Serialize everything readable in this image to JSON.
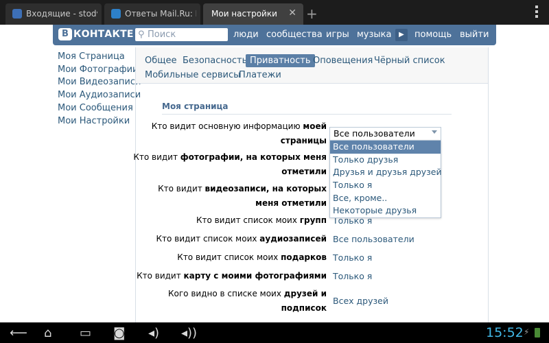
{
  "browser": {
    "tabs": [
      {
        "title": "Входящие - stodv…",
        "active": false
      },
      {
        "title": "Ответы Mail.Ru: В…",
        "active": false
      },
      {
        "title": "Мои настройки",
        "active": true
      }
    ]
  },
  "vk": {
    "logo_letter": "В",
    "logo_text": "КОНТАКТЕ",
    "search_placeholder": "Поиск",
    "nav": [
      "люди",
      "сообщества",
      "игры",
      "музыка",
      "помощь",
      "выйти"
    ]
  },
  "left_menu": [
    "Моя Страница",
    "Мои Фотографии",
    "Мои Видеозаписи",
    "Мои Аудиозаписи",
    "Мои Сообщения",
    "Мои Настройки"
  ],
  "settings": {
    "tabs_row1": [
      "Общее",
      "Безопасность",
      "Приватность",
      "Оповещения",
      "Чёрный список"
    ],
    "tabs_row2": [
      "Мобильные сервисы",
      "Платежи"
    ],
    "active_tab": "Приватность",
    "section_title": "Моя страница",
    "rows": [
      {
        "label_pre": "Кто видит основную информацию ",
        "label_bold": "моей",
        "label2_bold": "страницы",
        "value": "Все пользователи"
      },
      {
        "label_pre": "Кто видит ",
        "label_bold": "фотографии, на которых меня",
        "label2_bold": "отметили",
        "value": ""
      },
      {
        "label_pre": "Кто видит ",
        "label_bold": "видеозаписи, на которых",
        "label2_bold": "меня отметили",
        "value": ""
      },
      {
        "label_pre": "Кто видит список моих ",
        "label_bold": "групп",
        "value": "Только я"
      },
      {
        "label_pre": "Кто видит список моих ",
        "label_bold": "аудиозаписей",
        "value": "Все пользователи"
      },
      {
        "label_pre": "Кто видит список моих ",
        "label_bold": "подарков",
        "value": "Только я"
      },
      {
        "label_pre": "Кто видит ",
        "label_bold": "карту с моими фотографиями",
        "value": "Только я"
      },
      {
        "label_pre": "Кого видно в списке моих ",
        "label_bold": "друзей и",
        "label2_bold": "подписок",
        "value": "Всех друзей"
      }
    ],
    "dropdown": {
      "selected": "Все пользователи",
      "options": [
        "Все пользователи",
        "Только друзья",
        "Друзья и друзья друзей",
        "Только я",
        "Все, кроме..",
        "Некоторые друзья"
      ]
    }
  },
  "system_bar": {
    "time": "15:52"
  }
}
